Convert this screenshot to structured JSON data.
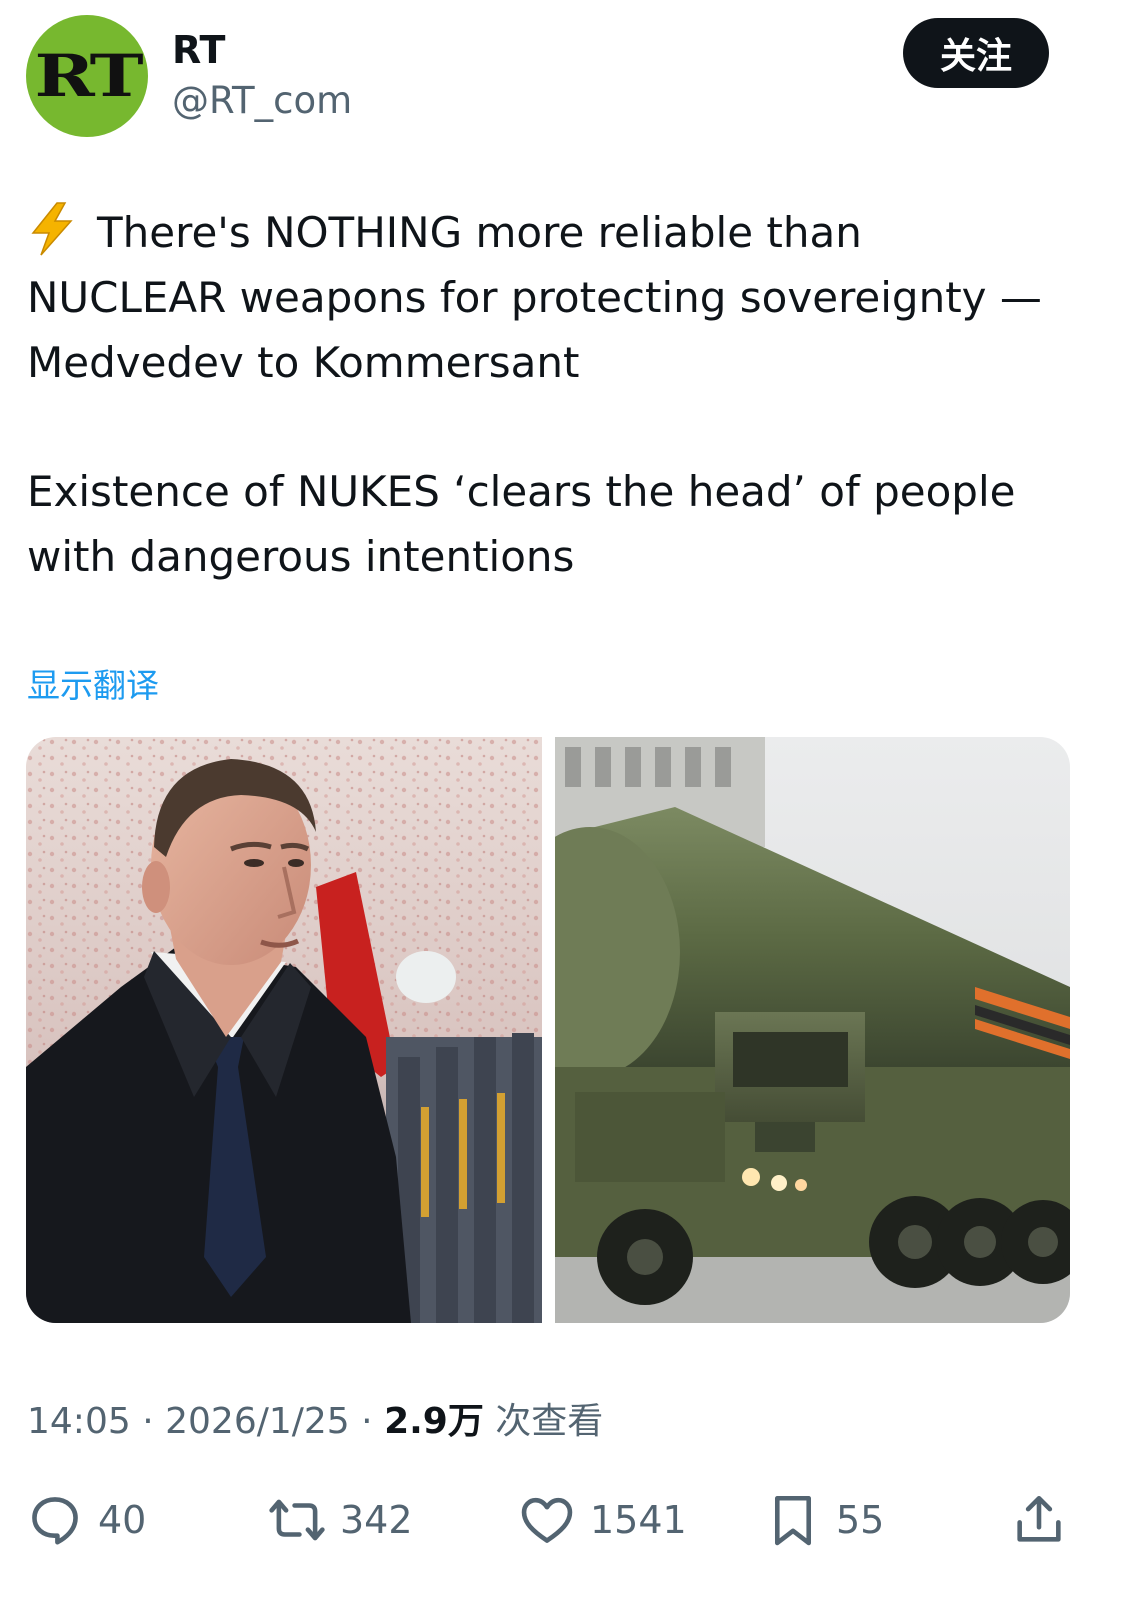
{
  "account": {
    "avatar_text": "RT",
    "display_name": "RT",
    "handle": "@RT_com",
    "follow_label": "关注"
  },
  "tweet": {
    "paragraph_1": "There's NOTHING more reliable than NUCLEAR weapons for protecting sovereignty — Medvedev to Kommersant",
    "paragraph_2": "Existence of NUKES ‘clears the head’ of people with dangerous intentions",
    "translate_label": "显示翻译"
  },
  "media": [
    {
      "icon": "photo-medvedev"
    },
    {
      "icon": "photo-missile-launcher"
    }
  ],
  "meta": {
    "time": "14:05",
    "separator": "·",
    "date": "2026/1/25",
    "views_count": "2.9万",
    "views_label": "次查看"
  },
  "actions": {
    "replies": "40",
    "retweets": "342",
    "likes": "1541",
    "bookmarks": "55"
  },
  "colors": {
    "brand_green": "#77b82f",
    "link_blue": "#1d9bf0",
    "muted_text": "#536471",
    "primary_text": "#0f1419"
  }
}
